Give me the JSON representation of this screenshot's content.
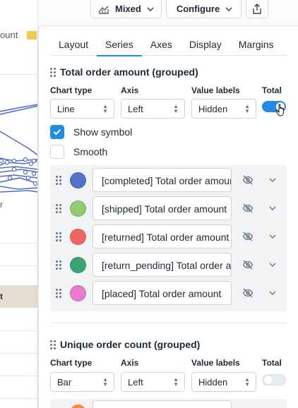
{
  "background": {
    "legend_text": "ount",
    "row_label": "r",
    "table_header": "t"
  },
  "toolbar": {
    "mixed_label": "Mixed",
    "configure_label": "Configure"
  },
  "tabs": [
    {
      "label": "Layout"
    },
    {
      "label": "Series"
    },
    {
      "label": "Axes"
    },
    {
      "label": "Display"
    },
    {
      "label": "Margins"
    }
  ],
  "active_tab": "Series",
  "sections": [
    {
      "title": "Total order amount (grouped)",
      "labels": {
        "chart_type": "Chart type",
        "axis": "Axis",
        "value_labels": "Value labels",
        "total": "Total"
      },
      "chart_type": "Line",
      "axis": "Left",
      "value_labels": "Hidden",
      "total_on": true,
      "show_symbol_label": "Show symbol",
      "show_symbol_checked": true,
      "smooth_label": "Smooth",
      "smooth_checked": false,
      "series": [
        {
          "name": "[completed] Total order amount",
          "color": "#5470c6"
        },
        {
          "name": "[shipped] Total order amount",
          "color": "#91cc75"
        },
        {
          "name": "[returned] Total order amount",
          "color": "#ee6666"
        },
        {
          "name": "[return_pending] Total order amount",
          "color": "#3ba272"
        },
        {
          "name": "[placed] Total order amount",
          "color": "#ea7ccc"
        }
      ]
    },
    {
      "title": "Unique order count (grouped)",
      "labels": {
        "chart_type": "Chart type",
        "axis": "Axis",
        "value_labels": "Value labels",
        "total": "Total"
      },
      "chart_type": "Bar",
      "axis": "Left",
      "value_labels": "Hidden",
      "total_on": false,
      "first_series_color": "#f08c3a"
    }
  ],
  "icons": [
    "mixed-chart-icon",
    "chevron-down-icon",
    "share-icon",
    "drag-handle-icon",
    "eye-off-icon",
    "up-down-icon",
    "check-icon"
  ],
  "colors": {
    "accent": "#228be6"
  }
}
